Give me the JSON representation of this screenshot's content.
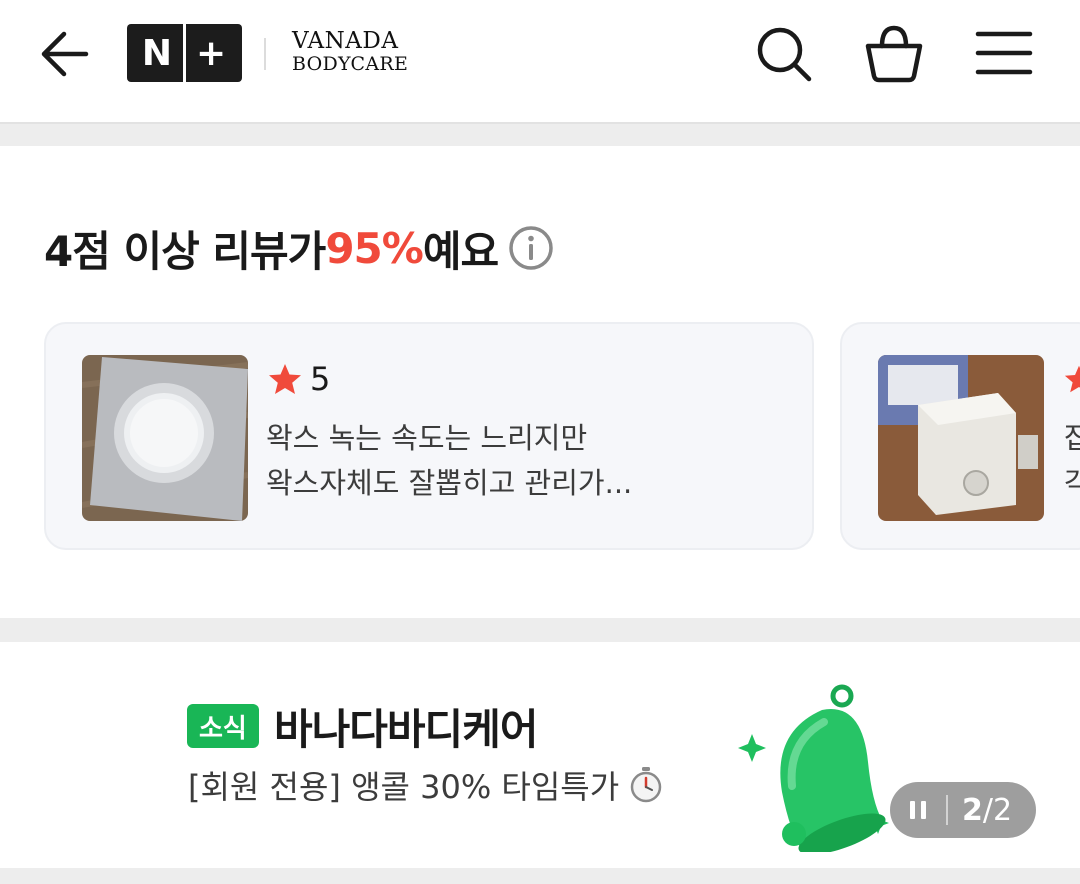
{
  "header": {
    "nplus_logo": "N+",
    "brand_line1": "VANADA",
    "brand_line2": "BODYCARE",
    "icons": [
      "back-arrow-icon",
      "search-icon",
      "shopping-basket-icon",
      "hamburger-menu-icon"
    ]
  },
  "reviews": {
    "title_prefix": "4점 이상 리뷰가 ",
    "title_percent": "95%",
    "title_suffix": "예요",
    "items": [
      {
        "rating": "5",
        "text_line1": "왁스 녹는 속도는 느리지만",
        "text_line2": "왁스자체도 잘뽑히고 관리가..."
      },
      {
        "text_line1": "잡",
        "text_line2": "각"
      }
    ]
  },
  "news": {
    "badge": "소식",
    "shop_name": "바나다바디케어",
    "promo_text": "[회원 전용] 앵콜 30% 타임특가",
    "pager_current": "2",
    "pager_separator": "/",
    "pager_total": "2"
  },
  "colors": {
    "accent_red": "#f04a3b",
    "badge_green": "#19b656",
    "star_red": "#f04a3b"
  }
}
